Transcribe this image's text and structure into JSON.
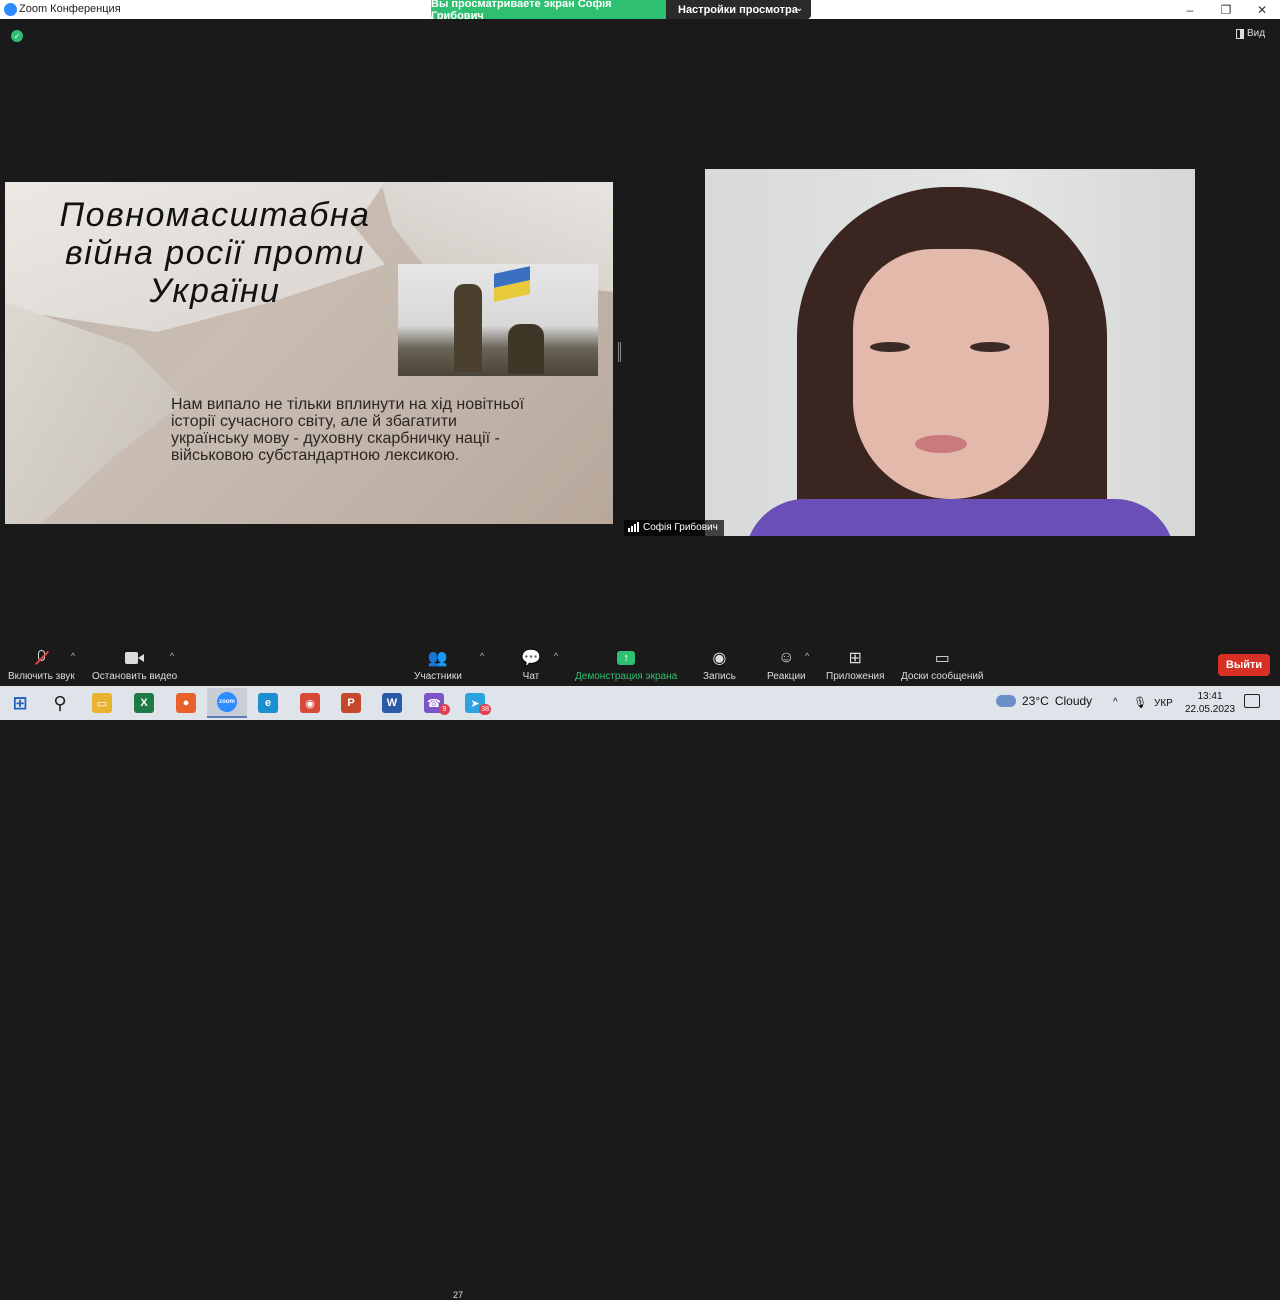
{
  "window": {
    "title": "Zoom Конференция",
    "minimize": "–",
    "maximize": "❐",
    "close": "✕"
  },
  "share_banner": {
    "viewing_text": "Вы просматриваете экран Софія Грибович",
    "view_options_label": "Настройки просмотра",
    "view_options_caret": "⌄"
  },
  "view_button": {
    "label": "Вид"
  },
  "slide": {
    "title": "Повномасштабна війна росії проти України",
    "body": "Нам випало не тільки вплинути на хід новітньої історії сучасного світу, але й збагатити українську мову - духовну скарбничку нації - військовою субстандартною лексикою."
  },
  "participant": {
    "name": "Софія Грибович"
  },
  "toolbar": {
    "unmute_label": "Включить звук",
    "stop_video_label": "Остановить видео",
    "participants_label": "Участники",
    "participants_count": "27",
    "chat_label": "Чат",
    "share_screen_label": "Демонстрация экрана",
    "record_label": "Запись",
    "reactions_label": "Реакции",
    "apps_label": "Приложения",
    "whiteboards_label": "Доски сообщений",
    "leave_label": "Выйти",
    "caret": "^"
  },
  "taskbar": {
    "apps": [
      {
        "name": "start",
        "glyph": "⊞",
        "color": "#1f5fbf"
      },
      {
        "name": "search",
        "glyph": "⚲",
        "color": "#222222"
      },
      {
        "name": "file-explorer",
        "glyph": "▭",
        "color": "#e8b430"
      },
      {
        "name": "excel",
        "glyph": "X",
        "color": "#1d7a45"
      },
      {
        "name": "firefox",
        "glyph": "●",
        "color": "#e8602c"
      },
      {
        "name": "zoom",
        "glyph": "zoom",
        "color": "#2d8cff"
      },
      {
        "name": "edge",
        "glyph": "e",
        "color": "#1b8fcf"
      },
      {
        "name": "chrome",
        "glyph": "◉",
        "color": "#d84a38"
      },
      {
        "name": "powerpoint",
        "glyph": "P",
        "color": "#c4482b"
      },
      {
        "name": "word",
        "glyph": "W",
        "color": "#2b5aa8"
      },
      {
        "name": "viber",
        "glyph": "☎",
        "color": "#7b54c7",
        "badge": "9"
      },
      {
        "name": "telegram",
        "glyph": "➤",
        "color": "#2aa3de",
        "badge": "38"
      }
    ],
    "weather_temp": "23°C",
    "weather_desc": "Cloudy",
    "tray_caret": "^",
    "language": "УКР",
    "time": "13:41",
    "date": "22.05.2023"
  }
}
